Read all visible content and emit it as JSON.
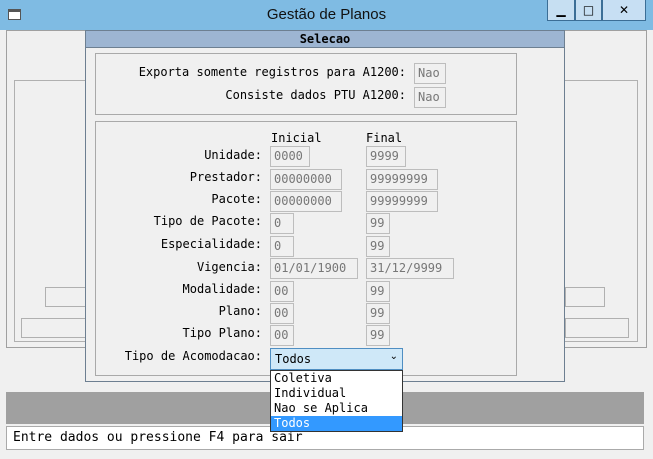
{
  "window": {
    "title": "Gestão de Planos",
    "minimize_glyph": "▁",
    "maximize_glyph": "□",
    "close_glyph": "✕"
  },
  "dialog": {
    "title": "Selecao",
    "export": {
      "label": "Exporta somente registros para A1200:",
      "value": "Nao"
    },
    "consiste": {
      "label": "Consiste dados PTU A1200:",
      "value": "Nao"
    },
    "headers": {
      "inicial": "Inicial",
      "final": "Final"
    },
    "rows": [
      {
        "label": "Unidade:",
        "inicial": "0000",
        "final": "9999"
      },
      {
        "label": "Prestador:",
        "inicial": "00000000",
        "final": "99999999"
      },
      {
        "label": "Pacote:",
        "inicial": "00000000",
        "final": "99999999"
      },
      {
        "label": "Tipo de Pacote:",
        "inicial": "0",
        "final": "99"
      },
      {
        "label": "Especialidade:",
        "inicial": "0",
        "final": "99"
      },
      {
        "label": "Vigencia:",
        "inicial": "01/01/1900",
        "final": "31/12/9999"
      },
      {
        "label": "Modalidade:",
        "inicial": "00",
        "final": "99"
      },
      {
        "label": "Plano:",
        "inicial": "00",
        "final": "99"
      },
      {
        "label": "Tipo Plano:",
        "inicial": "00",
        "final": "99"
      }
    ],
    "acomodacao": {
      "label": "Tipo de Acomodacao:",
      "selected": "Todos",
      "options": [
        "Coletiva",
        "Individual",
        "Nao se Aplica",
        "Todos"
      ]
    }
  },
  "status": {
    "message": "Entre dados ou pressione F4 para sair"
  }
}
